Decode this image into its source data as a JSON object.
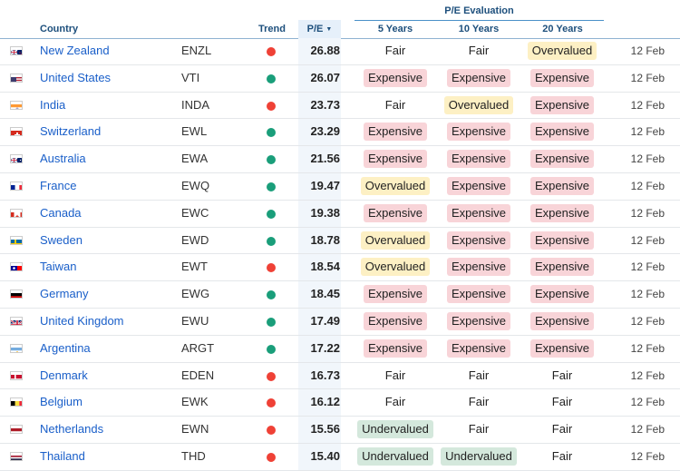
{
  "group_header": "P/E Evaluation",
  "columns": {
    "country": "Country",
    "trend": "Trend",
    "pe": "P/E",
    "y5": "5 Years",
    "y10": "10 Years",
    "y20": "20 Years"
  },
  "colors": {
    "trend_up": "#1a9e7a",
    "trend_down": "#ef4136"
  },
  "rows": [
    {
      "flag": "nz",
      "country": "New Zealand",
      "ticker": "ENZL",
      "trend": "down",
      "pe": "26.88",
      "y5": "Fair",
      "y10": "Fair",
      "y20": "Overvalued",
      "date": "12 Feb"
    },
    {
      "flag": "us",
      "country": "United States",
      "ticker": "VTI",
      "trend": "up",
      "pe": "26.07",
      "y5": "Expensive",
      "y10": "Expensive",
      "y20": "Expensive",
      "date": "12 Feb"
    },
    {
      "flag": "in",
      "country": "India",
      "ticker": "INDA",
      "trend": "down",
      "pe": "23.73",
      "y5": "Fair",
      "y10": "Overvalued",
      "y20": "Expensive",
      "date": "12 Feb"
    },
    {
      "flag": "ch",
      "country": "Switzerland",
      "ticker": "EWL",
      "trend": "up",
      "pe": "23.29",
      "y5": "Expensive",
      "y10": "Expensive",
      "y20": "Expensive",
      "date": "12 Feb"
    },
    {
      "flag": "au",
      "country": "Australia",
      "ticker": "EWA",
      "trend": "up",
      "pe": "21.56",
      "y5": "Expensive",
      "y10": "Expensive",
      "y20": "Expensive",
      "date": "12 Feb"
    },
    {
      "flag": "fr",
      "country": "France",
      "ticker": "EWQ",
      "trend": "up",
      "pe": "19.47",
      "y5": "Overvalued",
      "y10": "Expensive",
      "y20": "Expensive",
      "date": "12 Feb"
    },
    {
      "flag": "ca",
      "country": "Canada",
      "ticker": "EWC",
      "trend": "up",
      "pe": "19.38",
      "y5": "Expensive",
      "y10": "Expensive",
      "y20": "Expensive",
      "date": "12 Feb"
    },
    {
      "flag": "se",
      "country": "Sweden",
      "ticker": "EWD",
      "trend": "up",
      "pe": "18.78",
      "y5": "Overvalued",
      "y10": "Expensive",
      "y20": "Expensive",
      "date": "12 Feb"
    },
    {
      "flag": "tw",
      "country": "Taiwan",
      "ticker": "EWT",
      "trend": "down",
      "pe": "18.54",
      "y5": "Overvalued",
      "y10": "Expensive",
      "y20": "Expensive",
      "date": "12 Feb"
    },
    {
      "flag": "de",
      "country": "Germany",
      "ticker": "EWG",
      "trend": "up",
      "pe": "18.45",
      "y5": "Expensive",
      "y10": "Expensive",
      "y20": "Expensive",
      "date": "12 Feb"
    },
    {
      "flag": "gb",
      "country": "United Kingdom",
      "ticker": "EWU",
      "trend": "up",
      "pe": "17.49",
      "y5": "Expensive",
      "y10": "Expensive",
      "y20": "Expensive",
      "date": "12 Feb"
    },
    {
      "flag": "ar",
      "country": "Argentina",
      "ticker": "ARGT",
      "trend": "up",
      "pe": "17.22",
      "y5": "Expensive",
      "y10": "Expensive",
      "y20": "Expensive",
      "date": "12 Feb"
    },
    {
      "flag": "dk",
      "country": "Denmark",
      "ticker": "EDEN",
      "trend": "down",
      "pe": "16.73",
      "y5": "Fair",
      "y10": "Fair",
      "y20": "Fair",
      "date": "12 Feb"
    },
    {
      "flag": "be",
      "country": "Belgium",
      "ticker": "EWK",
      "trend": "down",
      "pe": "16.12",
      "y5": "Fair",
      "y10": "Fair",
      "y20": "Fair",
      "date": "12 Feb"
    },
    {
      "flag": "nl",
      "country": "Netherlands",
      "ticker": "EWN",
      "trend": "down",
      "pe": "15.56",
      "y5": "Undervalued",
      "y10": "Fair",
      "y20": "Fair",
      "date": "12 Feb"
    },
    {
      "flag": "th",
      "country": "Thailand",
      "ticker": "THD",
      "trend": "down",
      "pe": "15.40",
      "y5": "Undervalued",
      "y10": "Undervalued",
      "y20": "Fair",
      "date": "12 Feb"
    }
  ]
}
